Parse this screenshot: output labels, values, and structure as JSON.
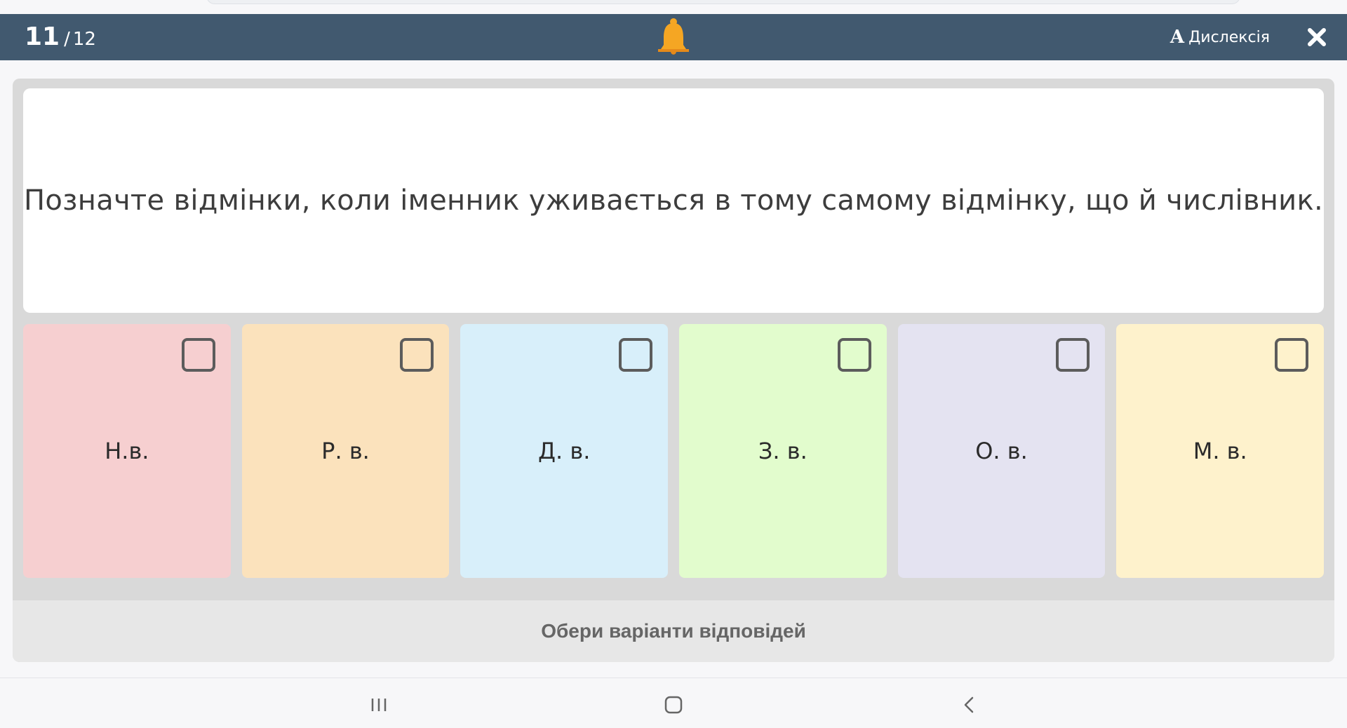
{
  "header": {
    "current_question": "11",
    "separator": "/",
    "total_questions": "12",
    "bell_icon": "bell-icon",
    "dyslexia_glyph": "A",
    "dyslexia_label": "Дислексія",
    "close_icon": "close-icon",
    "background_color": "#41596f",
    "bell_color": "#f5a623"
  },
  "question": {
    "text": "Позначте відмінки, коли іменник уживається в тому самому відмінку, що й числівник."
  },
  "options": [
    {
      "label": "Н.в.",
      "color": "#f6cfd0",
      "checked": false
    },
    {
      "label": "Р. в.",
      "color": "#fbe2bc",
      "checked": false
    },
    {
      "label": "Д. в.",
      "color": "#d8effa",
      "checked": false
    },
    {
      "label": "З. в.",
      "color": "#e2fccd",
      "checked": false
    },
    {
      "label": "О. в.",
      "color": "#e4e3f1",
      "checked": false
    },
    {
      "label": "М. в.",
      "color": "#fef2cc",
      "checked": false
    }
  ],
  "footer": {
    "hint": "Обери варіанти відповідей"
  },
  "system_nav": {
    "recents_icon": "recents-icon",
    "home_icon": "home-icon",
    "back_icon": "back-icon"
  }
}
